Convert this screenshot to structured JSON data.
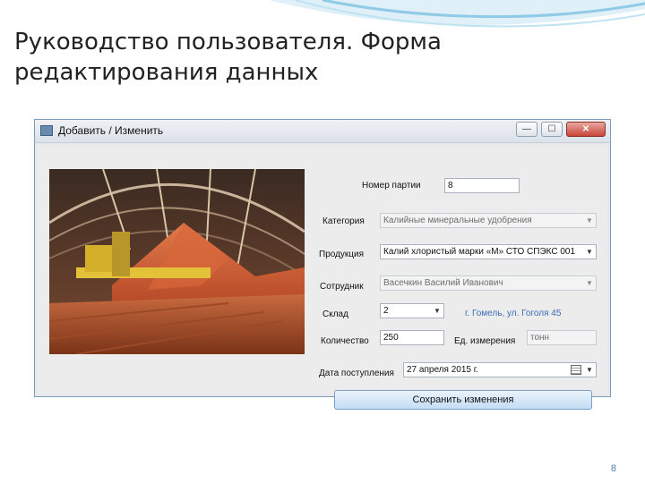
{
  "slide": {
    "title": "Руководство пользователя. Форма редактирования данных",
    "page_number": "8"
  },
  "window": {
    "title": "Добавить / Изменить",
    "controls": {
      "minimize": "—",
      "maximize": "☐",
      "close": "✕"
    }
  },
  "form": {
    "batch_number": {
      "label": "Номер партии",
      "value": "8"
    },
    "category": {
      "label": "Категория",
      "value": "Калийные минеральные удобрения"
    },
    "product": {
      "label": "Продукция",
      "value": "Калий хлористый марки «М» СТО СПЭКС 001"
    },
    "employee": {
      "label": "Сотрудник",
      "value": "Васечкин Василий Иванович"
    },
    "warehouse": {
      "label": "Склад",
      "value": "2",
      "address": "г. Гомель, ул. Гоголя 45"
    },
    "quantity": {
      "label": "Количество",
      "value": "250"
    },
    "unit": {
      "label": "Ед. измерения",
      "value": "тонн"
    },
    "received_date": {
      "label": "Дата поступления",
      "value": "27   апреля   2015 г."
    },
    "save_button": "Сохранить изменения"
  },
  "colors": {
    "accent": "#4a7fb5",
    "address": "#3a6db5",
    "close_button": "#c8453a"
  }
}
